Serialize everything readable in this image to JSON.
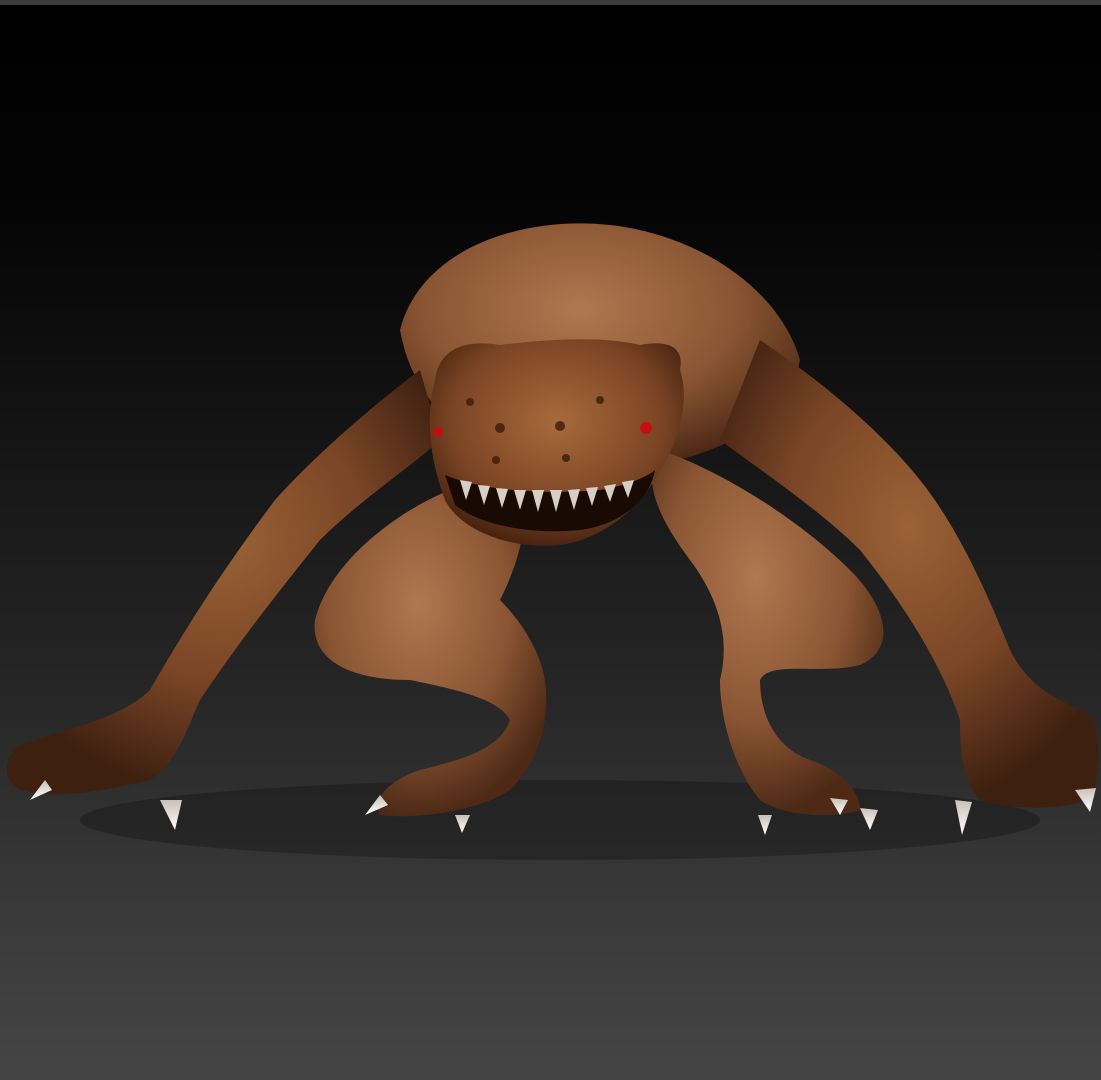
{
  "viewport": {
    "label": "",
    "background_top": "#000000",
    "background_bottom": "#454545"
  },
  "model": {
    "icon": "creature-model",
    "skin_color": "#7a4a2a",
    "claw_color": "#e8e8e8",
    "eye_color": "#c01010"
  }
}
